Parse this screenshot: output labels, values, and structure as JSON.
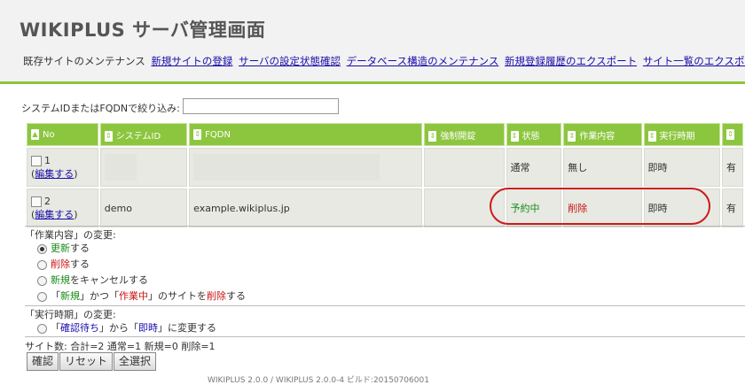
{
  "header": {
    "title": "WIKIPLUS サーバ管理画面",
    "nav_current": "既存サイトのメンテナンス",
    "nav_links": [
      "新規サイトの登録",
      "サーバの設定状態確認",
      "データベース構造のメンテナンス",
      "新規登録履歴のエクスポート",
      "サイト一覧のエクスポート"
    ]
  },
  "filter": {
    "label": "システムIDまたはFQDNで絞り込み:",
    "value": ""
  },
  "table": {
    "columns": [
      "No",
      "システムID",
      "FQDN",
      "強制開錠",
      "状態",
      "作業内容",
      "実行時期",
      "有"
    ],
    "rows": [
      {
        "no": "1",
        "edit": "編集する",
        "system_id": "",
        "fqdn": "",
        "force_unlock": "",
        "status": "通常",
        "task": "無し",
        "timing": "即時",
        "extra": "有"
      },
      {
        "no": "2",
        "edit": "編集する",
        "system_id": "demo",
        "fqdn": "example.wikiplus.jp",
        "force_unlock": "",
        "status": "予約中",
        "task": "削除",
        "timing": "即時",
        "extra": "有"
      }
    ]
  },
  "task_change": {
    "title": "「作業内容」の変更:",
    "opt1": {
      "a": "更新",
      "b": "する"
    },
    "opt2": {
      "a": "削除",
      "b": "する"
    },
    "opt3": {
      "a": "新規",
      "b": "をキャンセルする"
    },
    "opt4": {
      "a": "「",
      "b": "新規",
      "c": "」かつ「",
      "d": "作業中",
      "e": "」のサイトを",
      "f": "削除",
      "g": "する"
    }
  },
  "timing_change": {
    "title": "「実行時期」の変更:",
    "opt1": {
      "a": "「",
      "b": "確認待ち",
      "c": "」から「",
      "d": "即時",
      "e": "」に変更する"
    }
  },
  "counts": "サイト数: 合計=2 通常=1 新規=0 削除=1",
  "buttons": {
    "confirm": "確認",
    "reset": "リセット",
    "select_all": "全選択"
  },
  "footer": "WIKIPLUS 2.0.0 / WIKIPLUS 2.0.0-4 ビルド:20150706001",
  "colors": {
    "accent": "#8cc63f",
    "status_reserved": "#1a8a1a",
    "task_delete": "#c81414",
    "highlight_ring": "#cc1a1a"
  }
}
